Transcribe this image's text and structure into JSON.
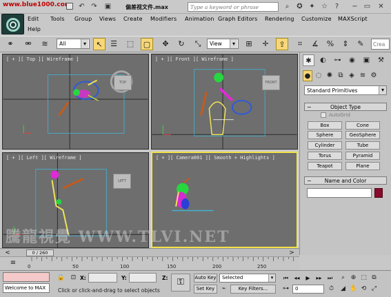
{
  "titlebar": {
    "watermark_url": "www.blue1000.com",
    "title": "偏差视文件.max",
    "search_placeholder": "Type a keyword or phrase"
  },
  "menu": {
    "items": [
      "Edit",
      "Tools",
      "Group",
      "Views",
      "Create",
      "Modifiers",
      "Animation",
      "Graph Editors",
      "Rendering",
      "Customize",
      "MAXScript",
      "Help"
    ]
  },
  "toolbar": {
    "selection_filter": "All",
    "reference_coord": "View",
    "search_field": "Crea"
  },
  "viewports": [
    {
      "label": "[ + ][ Top ][ Wireframe ]",
      "cube": "TOP"
    },
    {
      "label": "[ + ][ Front ][ Wireframe ]",
      "cube": "FRONT"
    },
    {
      "label": "[ + ][ Left ][ Wireframe ]",
      "cube": "LEFT"
    },
    {
      "label": "[ + ][ Camera001 ][ Smooth + Highlights ]",
      "cube": ""
    }
  ],
  "watermark_text": "騰龍視覺 WWW.TLVI.NET",
  "command_panel": {
    "category": "Standard Primitives",
    "object_type_title": "Object Type",
    "autogrid_label": "AutoGrid",
    "primitives": [
      "Box",
      "Cone",
      "Sphere",
      "GeoSphere",
      "Cylinder",
      "Tube",
      "Torus",
      "Pyramid",
      "Teapot",
      "Plane"
    ],
    "name_color_title": "Name and Color",
    "name_value": "",
    "swatch_color": "#8b0a2c"
  },
  "timeline": {
    "slider_label": "0 / 260",
    "ticks": [
      "0",
      "50",
      "100",
      "150",
      "200",
      "250"
    ]
  },
  "status": {
    "maxscript_output": "Welcome to MAX",
    "prompt": "Click or click-and-drag to select objects",
    "x_label": "X:",
    "y_label": "Y:",
    "z_label": "Z:",
    "auto_key": "Auto Key",
    "set_key": "Set Key",
    "selected_option": "Selected",
    "key_filters": "Key Filters...",
    "current_frame": "0"
  },
  "colors": {
    "active_viewport_border": "#f4e44a",
    "viewport_bg": "#6e6e6e",
    "active_tool": "#f7d778"
  }
}
